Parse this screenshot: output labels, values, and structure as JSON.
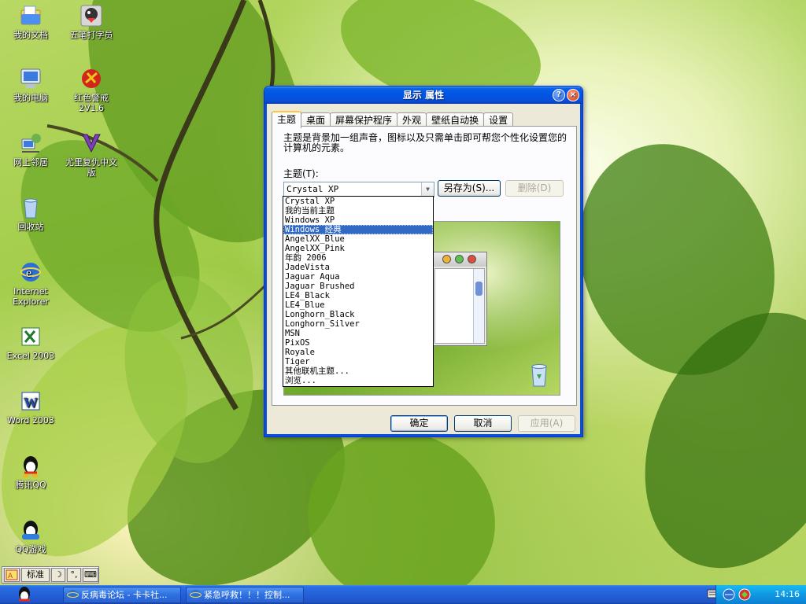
{
  "desktop": {
    "icons": [
      {
        "label": "我的文档",
        "icon": "my-documents-icon"
      },
      {
        "label": "五笔打字员",
        "icon": "typing-app-icon"
      },
      {
        "label": "我的电脑",
        "icon": "my-computer-icon"
      },
      {
        "label": "红色警戒 2V1.6",
        "icon": "red-alert-icon"
      },
      {
        "label": "网上邻居",
        "icon": "network-places-icon"
      },
      {
        "label": "尤里复仇中文版",
        "icon": "yuri-icon"
      },
      {
        "label": "回收站",
        "icon": "recycle-bin-icon"
      },
      {
        "label": "Internet Explorer",
        "icon": "ie-icon"
      },
      {
        "label": "Excel 2003",
        "icon": "excel-icon"
      },
      {
        "label": "Word 2003",
        "icon": "word-icon"
      },
      {
        "label": "腾讯QQ",
        "icon": "qq-icon"
      },
      {
        "label": "QQ游戏",
        "icon": "qq-game-icon"
      }
    ]
  },
  "dialog": {
    "title": "显示 属性",
    "help_glyph": "?",
    "close_glyph": "×",
    "tabs": [
      "主题",
      "桌面",
      "屏幕保护程序",
      "外观",
      "壁纸自动换",
      "设置"
    ],
    "description": "主题是背景加一组声音，图标以及只需单击即可帮您个性化设置您的计算机的元素。",
    "theme_label": "主题(T):",
    "combo_value": "Crystal XP",
    "save_as_label": "另存为(S)...",
    "delete_label": "删除(D)",
    "ok_label": "确定",
    "cancel_label": "取消",
    "apply_label": "应用(A)",
    "theme_options": [
      "Crystal XP",
      "我的当前主题",
      "Windows XP",
      "Windows 经典",
      "AngelXX_Blue",
      "AngelXX_Pink",
      "年韵 2006",
      "JadeVista",
      "Jaguar Aqua",
      "Jaguar Brushed",
      "LE4_Black",
      "LE4_Blue",
      "Longhorn_Black",
      "Longhorn_Silver",
      "MSN",
      "PixOS",
      "Royale",
      "Tiger",
      "其他联机主题...",
      "浏览..."
    ],
    "selected_option": "Windows 经典"
  },
  "langbar": {
    "mode": "标准",
    "punct": "°,",
    "icon": "ime-icon"
  },
  "taskbar": {
    "tasks": [
      {
        "label": "反病毒论坛 - 卡卡社...",
        "icon": "ie-icon"
      },
      {
        "label": "紧急呼救！！！控制...",
        "icon": "ie-icon"
      }
    ],
    "clock": "14:16"
  },
  "colors": {
    "title_blue": "#0055e5",
    "selection": "#316ac5",
    "dialog_bg": "#ece9d8",
    "tray_blue": "#0f98e3"
  }
}
